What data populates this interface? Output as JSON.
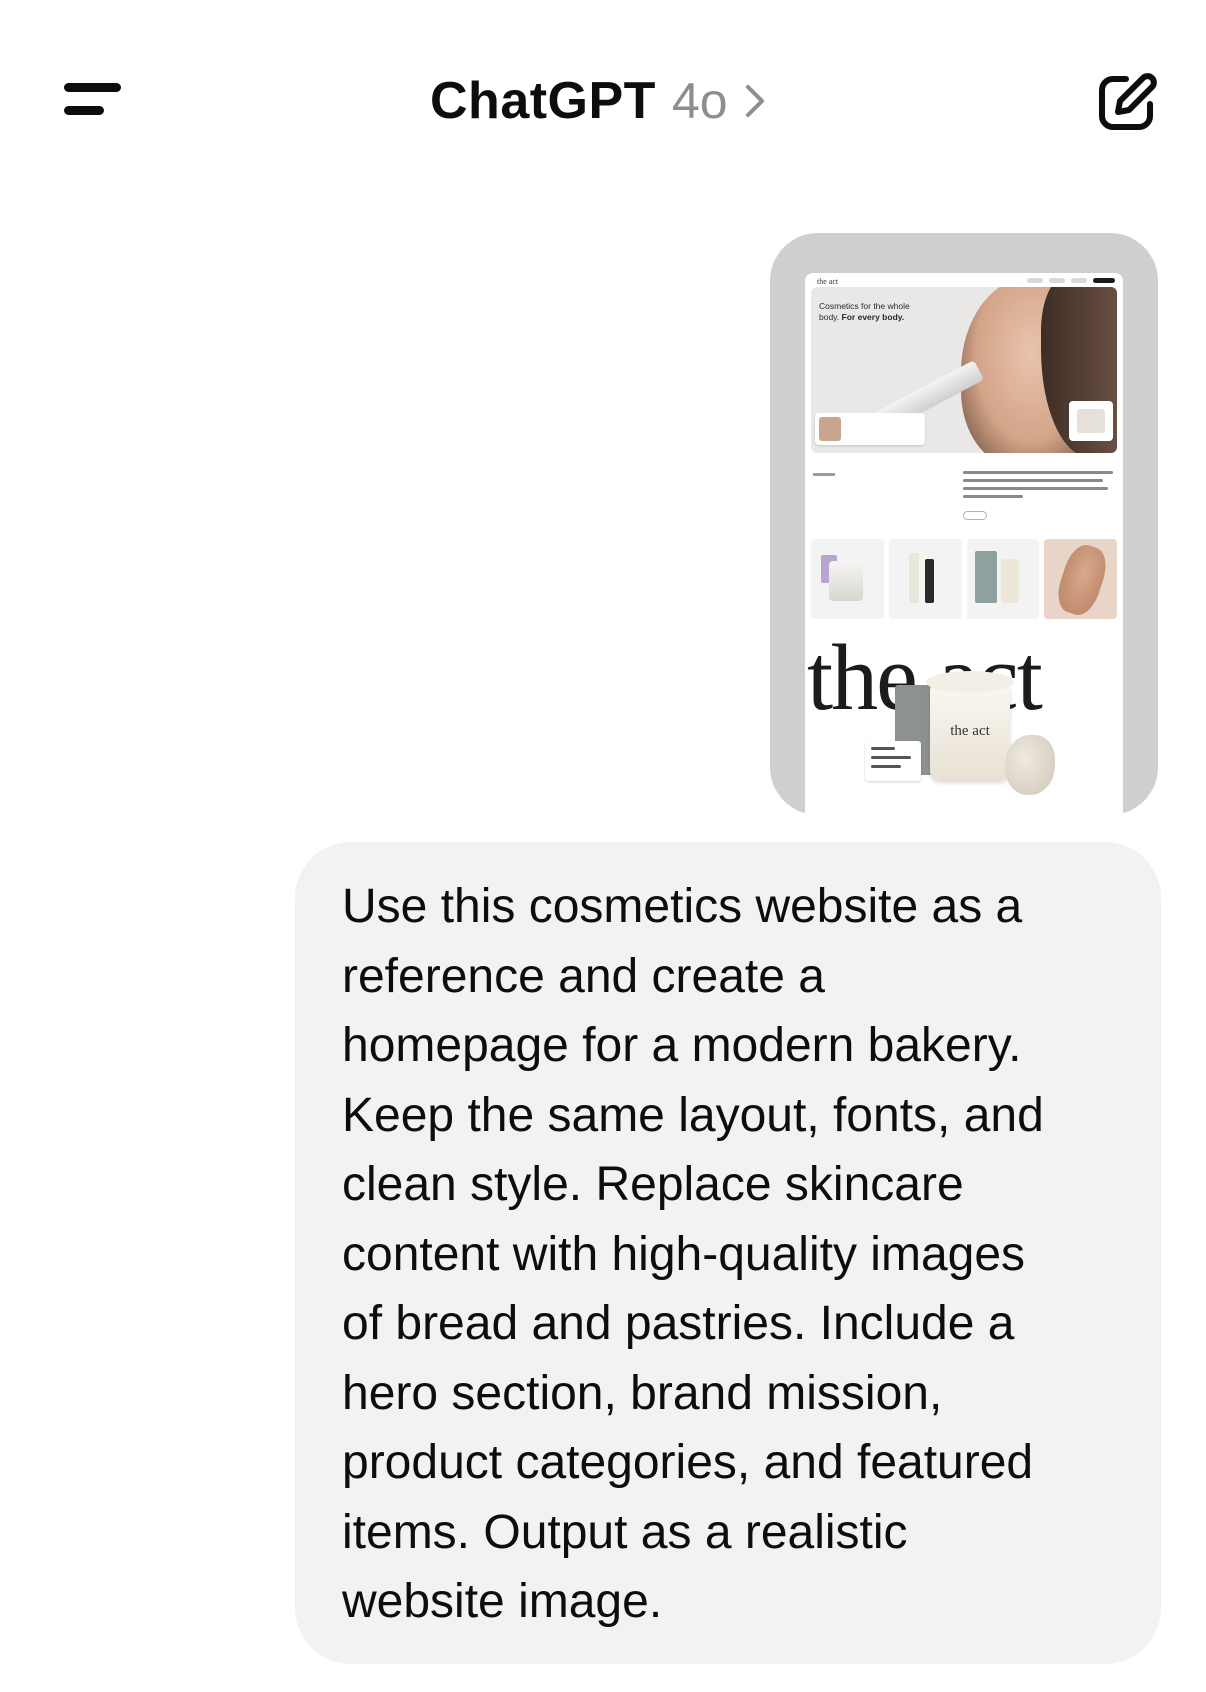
{
  "header": {
    "title": "ChatGPT",
    "model": "4o",
    "icons": {
      "menu": "sidebar-menu-icon",
      "chevron": "chevron-right-icon",
      "compose": "new-chat-icon"
    }
  },
  "attachment": {
    "site": {
      "logo_small": "the act",
      "hero_line1": "Cosmetics for the whole",
      "hero_line2_plain": "body.",
      "hero_line2_bold": "For every body.",
      "big_logo": "the act",
      "jar_label": "the act"
    }
  },
  "message": {
    "text": "Use this cosmetics website as a\nreference and create a\nhomepage for a modern bakery.\nKeep the same layout, fonts, and\nclean style. Replace skincare\ncontent with high-quality images\nof bread and pastries. Include a\nhero section, brand mission,\nproduct categories, and featured\nitems. Output as a realistic\nwebsite image."
  },
  "colors": {
    "bubble_bg": "#f2f2f2",
    "text": "#0d0d0d",
    "muted": "#8e8e8e"
  }
}
